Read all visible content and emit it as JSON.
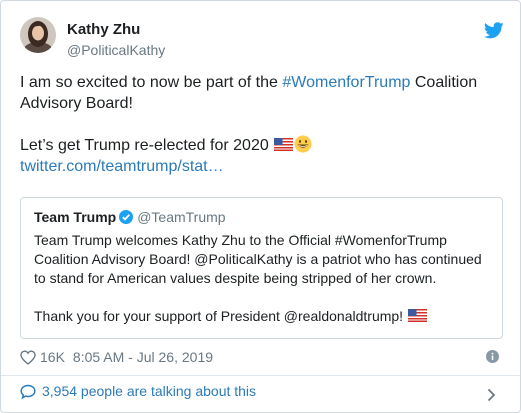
{
  "tweet": {
    "author_name": "Kathy Zhu",
    "author_handle": "@PoliticalKathy",
    "text_line1_prefix": "I am so excited to now be part of the ",
    "text_hashtag": "#WomenforTrump",
    "text_line1_suffix": " Coalition Advisory Board!",
    "text_line2_prefix": "Let’s get Trump re-elected for 2020 ",
    "text_link": "twitter.com/teamtrump/stat…",
    "likes": "16K",
    "timestamp": "8:05 AM - Jul 26, 2019",
    "talking": "3,954 people are talking about this"
  },
  "quoted": {
    "author_name": "Team Trump",
    "author_handle": "@TeamTrump",
    "paragraph1": "Team Trump welcomes Kathy Zhu to the Official #WomenforTrump Coalition Advisory Board! @PoliticalKathy is a patriot who has continued to stand for American values despite being stripped of her crown.",
    "paragraph2": "Thank you for your support of President @realdonaldtrump! "
  },
  "icons": {
    "bird": "twitter-bird-icon",
    "flag": "us-flag-icon",
    "emoji": "grinning-face-icon",
    "verified": "verified-badge-icon",
    "heart": "heart-icon",
    "info": "info-icon",
    "bubble": "speech-bubble-icon",
    "chevron": "chevron-right-icon"
  },
  "colors": {
    "link": "#2b7bb9",
    "twitter_blue": "#1da1f2",
    "muted": "#697882",
    "text": "#1c2022",
    "border": "#cfd9de"
  }
}
